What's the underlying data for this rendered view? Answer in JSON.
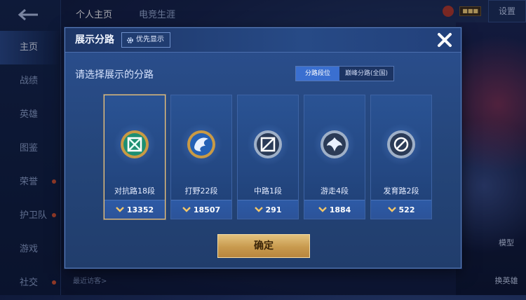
{
  "background": {
    "back_icon": "back-arrow-icon",
    "nav": [
      {
        "label": "主页",
        "active": true,
        "dot": false
      },
      {
        "label": "战绩",
        "active": false,
        "dot": false
      },
      {
        "label": "英雄",
        "active": false,
        "dot": false
      },
      {
        "label": "图鉴",
        "active": false,
        "dot": false
      },
      {
        "label": "荣誉",
        "active": false,
        "dot": true
      },
      {
        "label": "护卫队",
        "active": false,
        "dot": true
      },
      {
        "label": "游戏",
        "active": false,
        "dot": false
      },
      {
        "label": "社交",
        "active": false,
        "dot": true
      }
    ],
    "tabs": [
      "个人主页",
      "电竞生涯"
    ],
    "settings_label": "设置",
    "right_label_1": "模型",
    "right_label_2": "换英雄",
    "recent_visitors": "最近访客>"
  },
  "modal": {
    "title": "展示分路",
    "priority_label": "优先显示",
    "subtitle": "请选择展示的分路",
    "segments": [
      "分路段位",
      "巅峰分路(全国)"
    ],
    "active_segment": 0,
    "confirm_label": "确定",
    "accent_color": "#f0c57a",
    "lanes": [
      {
        "name": "对抗路18段",
        "score": "13352",
        "selected": true,
        "icon": "clash-lane-emblem-icon"
      },
      {
        "name": "打野22段",
        "score": "18507",
        "selected": false,
        "icon": "jungle-emblem-icon"
      },
      {
        "name": "中路1段",
        "score": "291",
        "selected": false,
        "icon": "mid-lane-emblem-icon"
      },
      {
        "name": "游走4段",
        "score": "1884",
        "selected": false,
        "icon": "roam-emblem-icon"
      },
      {
        "name": "发育路2段",
        "score": "522",
        "selected": false,
        "icon": "farm-lane-emblem-icon"
      }
    ]
  }
}
